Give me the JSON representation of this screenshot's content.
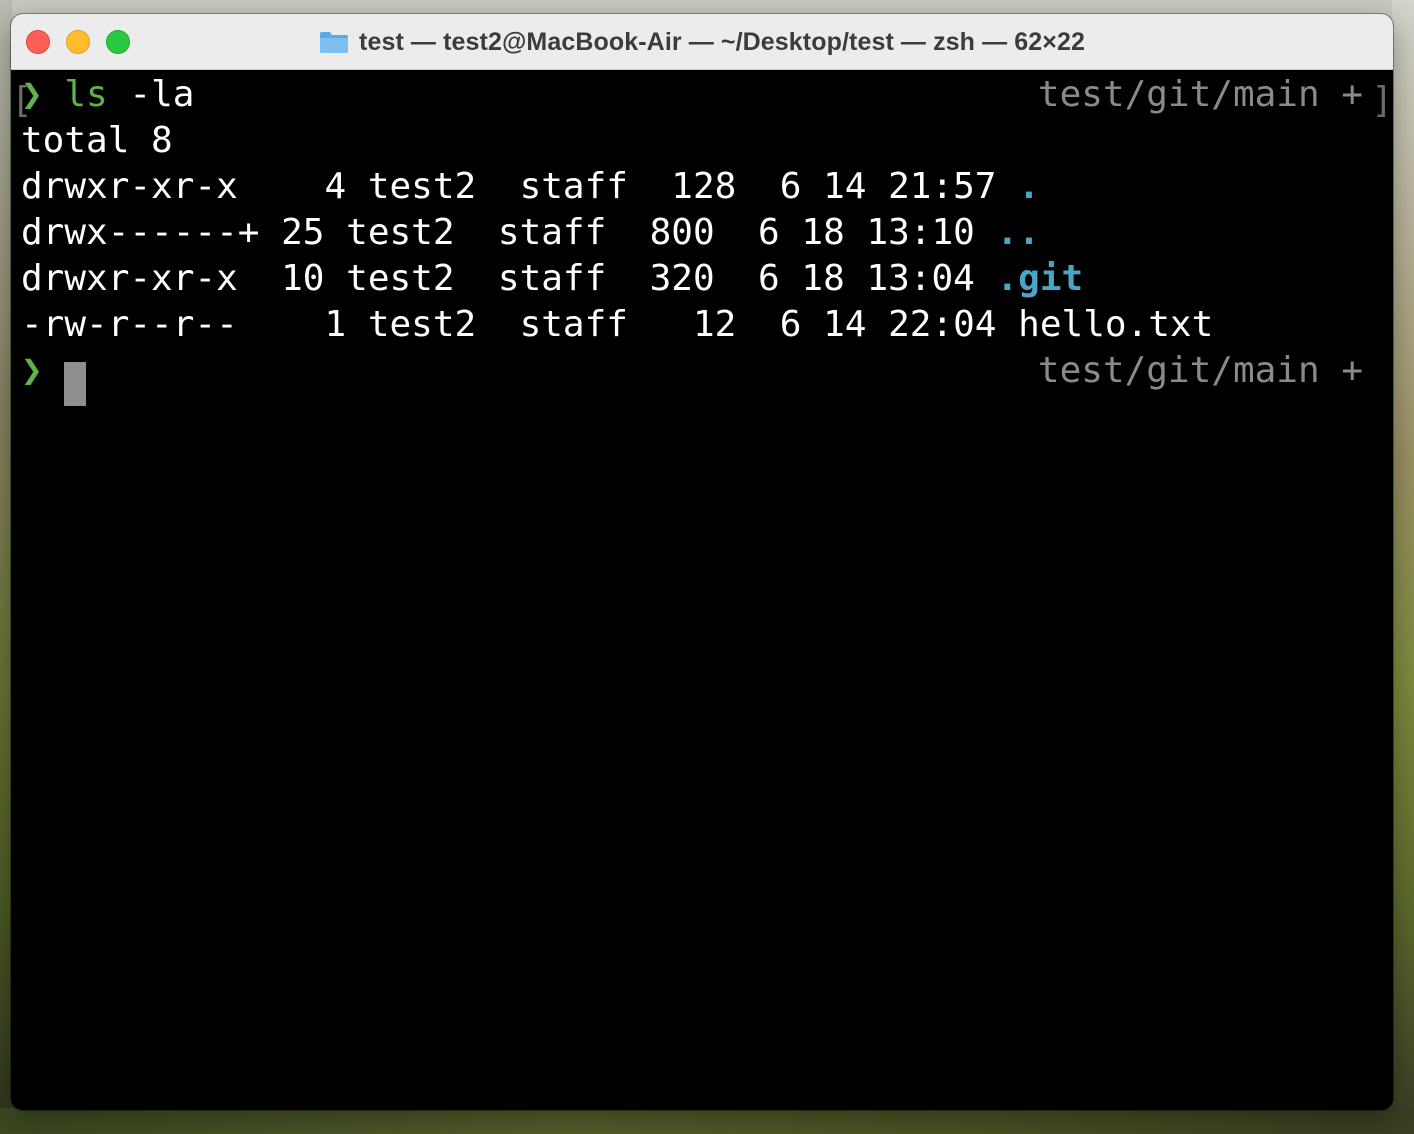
{
  "window": {
    "title": "test — test2@MacBook-Air — ~/Desktop/test — zsh — 62×22"
  },
  "terminal": {
    "prompt_symbol": "❯",
    "command": "ls",
    "command_args": " -la",
    "right_prompt": "test/git/main +",
    "output": {
      "total": "total 8",
      "rows": [
        {
          "perms": "drwxr-xr-x",
          "links": " 4",
          "owner": "test2",
          "group": "staff",
          "size": "128",
          "month": "6",
          "day": "14",
          "time": "21:57",
          "name": "."
        },
        {
          "perms": "drwx------+",
          "links": "25",
          "owner": "test2",
          "group": "staff",
          "size": "800",
          "month": "6",
          "day": "18",
          "time": "13:10",
          "name": ".."
        },
        {
          "perms": "drwxr-xr-x",
          "links": "10",
          "owner": "test2",
          "group": "staff",
          "size": "320",
          "month": "6",
          "day": "18",
          "time": "13:04",
          "name": ".git"
        },
        {
          "perms": "-rw-r--r--",
          "links": " 1",
          "owner": "test2",
          "group": "staff",
          "size": " 12",
          "month": "6",
          "day": "14",
          "time": "22:04",
          "name": "hello.txt"
        }
      ]
    },
    "bracket_left": "[",
    "bracket_right": "]"
  },
  "colors": {
    "prompt_green": "#5fb34a",
    "directory_cyan": "#4aa6c4",
    "right_prompt_gray": "#8a8a8a",
    "terminal_bg": "#000000",
    "close": "#fe5f57",
    "minimize": "#febc2e",
    "zoom": "#28c840"
  },
  "icons": {
    "title_icon": "folder-icon"
  }
}
